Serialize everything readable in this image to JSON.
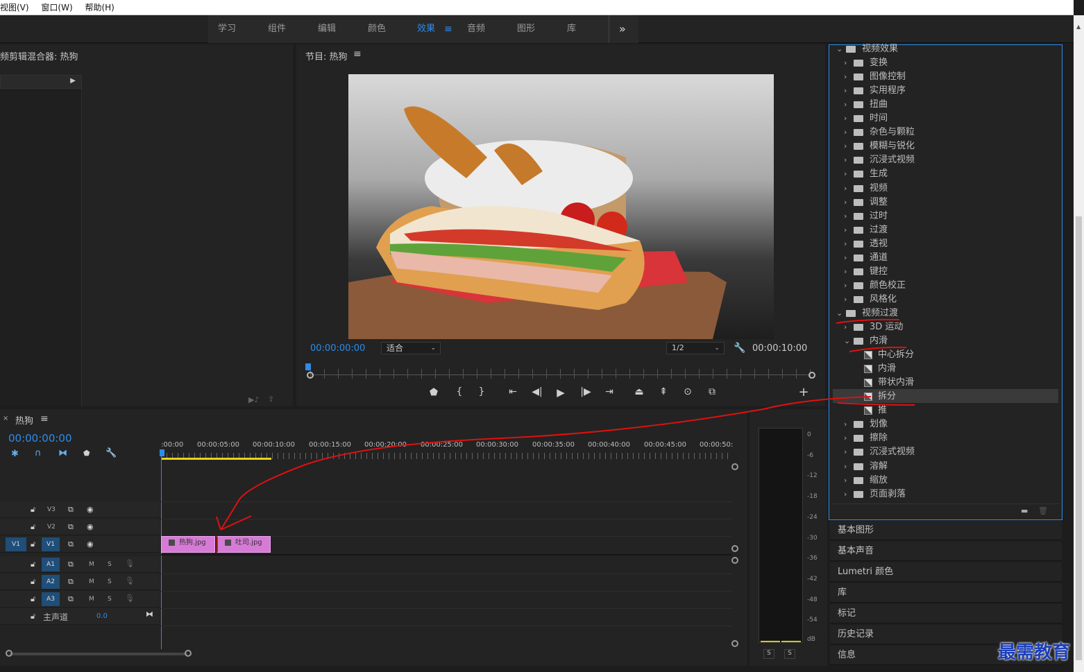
{
  "menu": [
    "视图(V)",
    "窗口(W)",
    "帮助(H)"
  ],
  "workspace_tabs": [
    "学习",
    "组件",
    "编辑",
    "颜色",
    "效果",
    "音频",
    "图形",
    "库"
  ],
  "workspace_active": "效果",
  "workspace_more": "»",
  "source_panel": {
    "title": "频剪辑混合器: 热狗"
  },
  "program_monitor": {
    "title": "节目: 热狗",
    "timecode_in": "00:00:00:00",
    "zoom": "适合",
    "resolution": "1/2",
    "timecode_out": "00:00:10:00"
  },
  "timeline": {
    "title": "热狗",
    "timecode": "00:00:00:00",
    "ruler": [
      ":00:00",
      "00:00:05:00",
      "00:00:10:00",
      "00:00:15:00",
      "00:00:20:00",
      "00:00:25:00",
      "00:00:30:00",
      "00:00:35:00",
      "00:00:40:00",
      "00:00:45:00",
      "00:00:50:"
    ],
    "video_tracks": [
      "V3",
      "V2",
      "V1"
    ],
    "source_patch": "V1",
    "audio_tracks": [
      "A1",
      "A2",
      "A3"
    ],
    "mute_label": "M",
    "solo_label": "S",
    "master_label": "主声道",
    "master_value": "0.0",
    "clips": [
      "热狗.jpg",
      "吐司.jpg"
    ]
  },
  "meter": {
    "labels": [
      "0",
      "-6",
      "-12",
      "-18",
      "-24",
      "-30",
      "-36",
      "-42",
      "-48",
      "-54",
      "dB"
    ],
    "solo": [
      "S",
      "S"
    ]
  },
  "effects": {
    "video_effects": "视频效果",
    "effect_folders": [
      "变换",
      "图像控制",
      "实用程序",
      "扭曲",
      "时间",
      "杂色与颗粒",
      "模糊与锐化",
      "沉浸式视频",
      "生成",
      "视频",
      "调整",
      "过时",
      "过渡",
      "透视",
      "通道",
      "键控",
      "颜色校正",
      "风格化"
    ],
    "video_transitions": "视频过渡",
    "transition_folder_before": "3D 运动",
    "open_folder": "内滑",
    "open_items": [
      "中心拆分",
      "内滑",
      "带状内滑",
      "拆分",
      "推"
    ],
    "selected_item": "拆分",
    "transition_folders_after": [
      "划像",
      "擦除",
      "沉浸式视频",
      "溶解",
      "缩放",
      "页面剥落"
    ]
  },
  "side_panels": [
    "基本图形",
    "基本声音",
    "Lumetri 颜色",
    "库",
    "标记",
    "历史记录",
    "信息"
  ],
  "watermark": "最需教育",
  "colors": {
    "accent": "#2d8ceb",
    "clip": "#d57bd5",
    "annotation": "#e01010",
    "panel": "#232323"
  }
}
